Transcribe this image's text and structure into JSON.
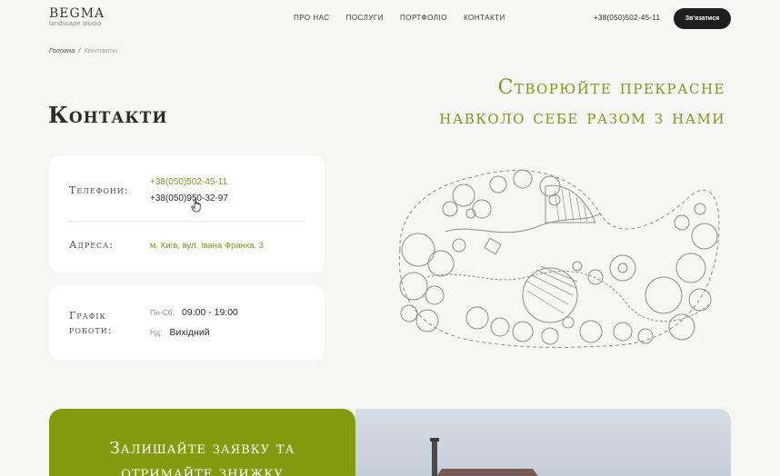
{
  "brand": {
    "name": "BEGMA",
    "tagline": "landscape studio"
  },
  "nav": {
    "items": [
      "ПРО НАС",
      "ПОСЛУГИ",
      "ПОРТФОЛІО",
      "КОНТАКТИ"
    ]
  },
  "header": {
    "phone": "+38(050)502-45-11",
    "cta_label": "Зв'язатися"
  },
  "breadcrumb": {
    "home": "Головна",
    "separator": "/",
    "current": "Контакти"
  },
  "page_title": "Контакти",
  "hero": {
    "line1": "Створюйте прекрасне",
    "line2": "навколо себе разом з нами"
  },
  "contacts": {
    "phones_label": "Телефони:",
    "phone_1": "+38(050)502-45-11",
    "phone_2": "+38(050)950-32-97",
    "address_label": "Адреса:",
    "address": "м. Київ, вул. Івана Франка, 3"
  },
  "schedule": {
    "label_line1": "Графік",
    "label_line2": "роботи:",
    "weekday_label": "Пн-Сб:",
    "weekday_hours": "09:00 - 19:00",
    "sunday_label": "Нд:",
    "sunday_hours": "Вихідний"
  },
  "banner": {
    "line1": "Залишайте заявку та",
    "line2": "отримайте знижку"
  },
  "colors": {
    "accent": "#7d9a1c",
    "banner": "#849a0f",
    "dark": "#1f1f1f",
    "background": "#f6f6f4"
  },
  "icons": {
    "cursor": "hand-pointer-icon",
    "plan": "landscape-plan-illustration"
  }
}
